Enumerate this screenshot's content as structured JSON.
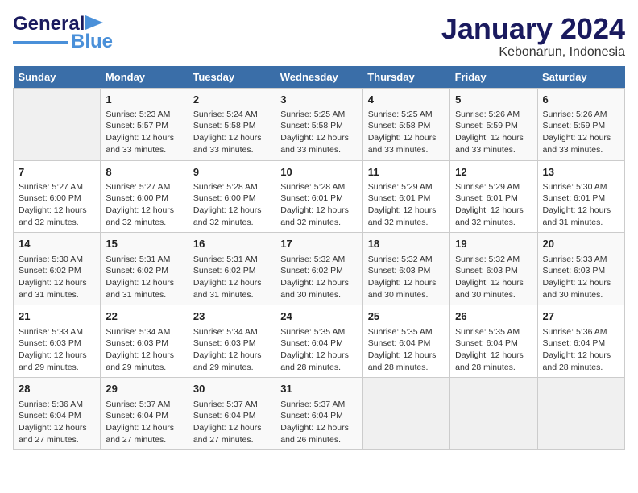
{
  "logo": {
    "text1": "General",
    "text2": "Blue"
  },
  "title": "January 2024",
  "subtitle": "Kebonarun, Indonesia",
  "weekdays": [
    "Sunday",
    "Monday",
    "Tuesday",
    "Wednesday",
    "Thursday",
    "Friday",
    "Saturday"
  ],
  "weeks": [
    [
      {
        "day": "",
        "info": ""
      },
      {
        "day": "1",
        "info": "Sunrise: 5:23 AM\nSunset: 5:57 PM\nDaylight: 12 hours\nand 33 minutes."
      },
      {
        "day": "2",
        "info": "Sunrise: 5:24 AM\nSunset: 5:58 PM\nDaylight: 12 hours\nand 33 minutes."
      },
      {
        "day": "3",
        "info": "Sunrise: 5:25 AM\nSunset: 5:58 PM\nDaylight: 12 hours\nand 33 minutes."
      },
      {
        "day": "4",
        "info": "Sunrise: 5:25 AM\nSunset: 5:58 PM\nDaylight: 12 hours\nand 33 minutes."
      },
      {
        "day": "5",
        "info": "Sunrise: 5:26 AM\nSunset: 5:59 PM\nDaylight: 12 hours\nand 33 minutes."
      },
      {
        "day": "6",
        "info": "Sunrise: 5:26 AM\nSunset: 5:59 PM\nDaylight: 12 hours\nand 33 minutes."
      }
    ],
    [
      {
        "day": "7",
        "info": "Sunrise: 5:27 AM\nSunset: 6:00 PM\nDaylight: 12 hours\nand 32 minutes."
      },
      {
        "day": "8",
        "info": "Sunrise: 5:27 AM\nSunset: 6:00 PM\nDaylight: 12 hours\nand 32 minutes."
      },
      {
        "day": "9",
        "info": "Sunrise: 5:28 AM\nSunset: 6:00 PM\nDaylight: 12 hours\nand 32 minutes."
      },
      {
        "day": "10",
        "info": "Sunrise: 5:28 AM\nSunset: 6:01 PM\nDaylight: 12 hours\nand 32 minutes."
      },
      {
        "day": "11",
        "info": "Sunrise: 5:29 AM\nSunset: 6:01 PM\nDaylight: 12 hours\nand 32 minutes."
      },
      {
        "day": "12",
        "info": "Sunrise: 5:29 AM\nSunset: 6:01 PM\nDaylight: 12 hours\nand 32 minutes."
      },
      {
        "day": "13",
        "info": "Sunrise: 5:30 AM\nSunset: 6:01 PM\nDaylight: 12 hours\nand 31 minutes."
      }
    ],
    [
      {
        "day": "14",
        "info": "Sunrise: 5:30 AM\nSunset: 6:02 PM\nDaylight: 12 hours\nand 31 minutes."
      },
      {
        "day": "15",
        "info": "Sunrise: 5:31 AM\nSunset: 6:02 PM\nDaylight: 12 hours\nand 31 minutes."
      },
      {
        "day": "16",
        "info": "Sunrise: 5:31 AM\nSunset: 6:02 PM\nDaylight: 12 hours\nand 31 minutes."
      },
      {
        "day": "17",
        "info": "Sunrise: 5:32 AM\nSunset: 6:02 PM\nDaylight: 12 hours\nand 30 minutes."
      },
      {
        "day": "18",
        "info": "Sunrise: 5:32 AM\nSunset: 6:03 PM\nDaylight: 12 hours\nand 30 minutes."
      },
      {
        "day": "19",
        "info": "Sunrise: 5:32 AM\nSunset: 6:03 PM\nDaylight: 12 hours\nand 30 minutes."
      },
      {
        "day": "20",
        "info": "Sunrise: 5:33 AM\nSunset: 6:03 PM\nDaylight: 12 hours\nand 30 minutes."
      }
    ],
    [
      {
        "day": "21",
        "info": "Sunrise: 5:33 AM\nSunset: 6:03 PM\nDaylight: 12 hours\nand 29 minutes."
      },
      {
        "day": "22",
        "info": "Sunrise: 5:34 AM\nSunset: 6:03 PM\nDaylight: 12 hours\nand 29 minutes."
      },
      {
        "day": "23",
        "info": "Sunrise: 5:34 AM\nSunset: 6:03 PM\nDaylight: 12 hours\nand 29 minutes."
      },
      {
        "day": "24",
        "info": "Sunrise: 5:35 AM\nSunset: 6:04 PM\nDaylight: 12 hours\nand 28 minutes."
      },
      {
        "day": "25",
        "info": "Sunrise: 5:35 AM\nSunset: 6:04 PM\nDaylight: 12 hours\nand 28 minutes."
      },
      {
        "day": "26",
        "info": "Sunrise: 5:35 AM\nSunset: 6:04 PM\nDaylight: 12 hours\nand 28 minutes."
      },
      {
        "day": "27",
        "info": "Sunrise: 5:36 AM\nSunset: 6:04 PM\nDaylight: 12 hours\nand 28 minutes."
      }
    ],
    [
      {
        "day": "28",
        "info": "Sunrise: 5:36 AM\nSunset: 6:04 PM\nDaylight: 12 hours\nand 27 minutes."
      },
      {
        "day": "29",
        "info": "Sunrise: 5:37 AM\nSunset: 6:04 PM\nDaylight: 12 hours\nand 27 minutes."
      },
      {
        "day": "30",
        "info": "Sunrise: 5:37 AM\nSunset: 6:04 PM\nDaylight: 12 hours\nand 27 minutes."
      },
      {
        "day": "31",
        "info": "Sunrise: 5:37 AM\nSunset: 6:04 PM\nDaylight: 12 hours\nand 26 minutes."
      },
      {
        "day": "",
        "info": ""
      },
      {
        "day": "",
        "info": ""
      },
      {
        "day": "",
        "info": ""
      }
    ]
  ]
}
